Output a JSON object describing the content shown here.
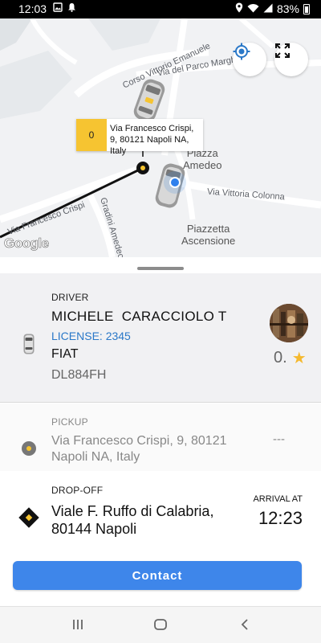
{
  "status_bar": {
    "time": "12:03",
    "battery": "83%",
    "icons": [
      "image-icon",
      "notification-bell-icon",
      "location-icon",
      "wifi-icon",
      "signal-icon",
      "battery-icon"
    ]
  },
  "map": {
    "pin_eta": "0",
    "pin_address": "Via Francesco Crispi, 9, 80121 Napoli NA, Italy",
    "street_labels": {
      "corso": "Corso Vittorio Emanuele",
      "parco": "Via del Parco Margherita",
      "vittoria": "Via Vittoria Colonna",
      "crispi": "Via Francesco Crispi",
      "gradini": "Gradini Amedeo",
      "piazza_amedeo_1": "Piazza",
      "piazza_amedeo_2": "Amedeo",
      "piazzetta_1": "Piazzetta",
      "piazzetta_2": "Ascensione"
    },
    "provider": "Google",
    "buttons": [
      "my-location-icon",
      "fullscreen-icon"
    ]
  },
  "driver": {
    "label": "DRIVER",
    "name": "MICHELE  CARACCIOLO T",
    "license": "LICENSE: 2345",
    "make": "FIAT",
    "plate": "DL884FH",
    "rating": "0."
  },
  "pickup": {
    "label": "PICKUP",
    "address": "Via Francesco Crispi, 9, 80121 Napoli NA, Italy",
    "time": "---"
  },
  "dropoff": {
    "label": "DROP-OFF",
    "address": "Viale F. Ruffo di Calabria, 80144 Napoli",
    "arrival_label": "ARRIVAL AT",
    "arrival_time": "12:23"
  },
  "contact_button": "Contact",
  "colors": {
    "accent": "#3e86ea",
    "taxi_yellow": "#f6c431",
    "license_blue": "#2a78c8",
    "star": "#f5b92e"
  },
  "nav": [
    "recent-apps-icon",
    "home-icon",
    "back-icon"
  ]
}
